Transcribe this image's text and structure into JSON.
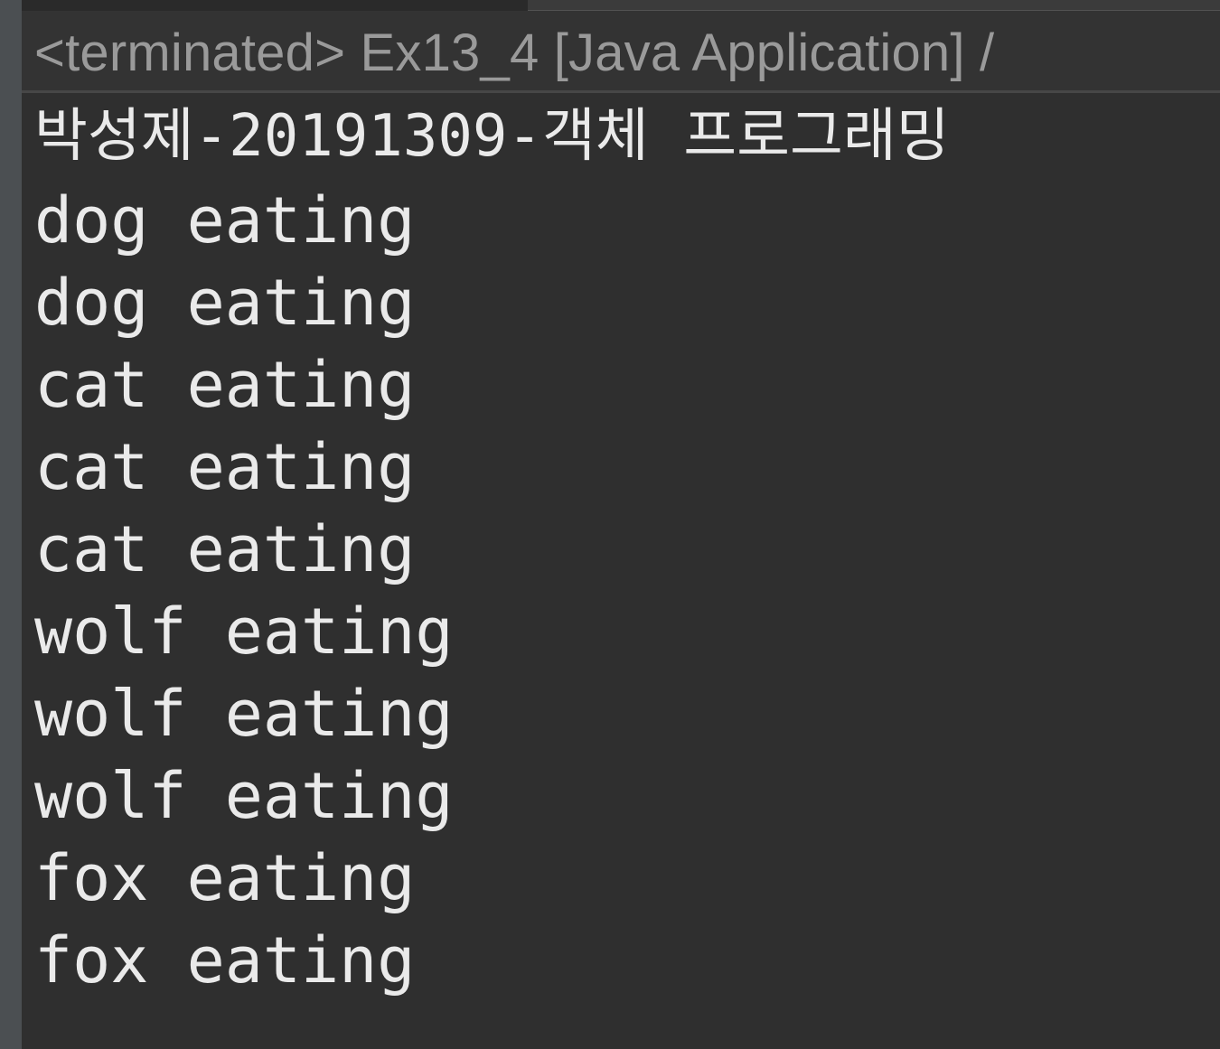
{
  "console": {
    "header": "<terminated> Ex13_4 [Java Application] /",
    "lines": [
      "박성제-20191309-객체 프로그래밍",
      "dog eating",
      "dog eating",
      "cat eating",
      "cat eating",
      "cat eating",
      "wolf eating",
      "wolf eating",
      "wolf eating",
      "fox eating",
      "fox eating"
    ]
  },
  "colors": {
    "background": "#2f2f2f",
    "header_background": "#333333",
    "header_text": "#9a9a9a",
    "output_text": "#eaeaea",
    "gutter": "#4b4f52"
  }
}
